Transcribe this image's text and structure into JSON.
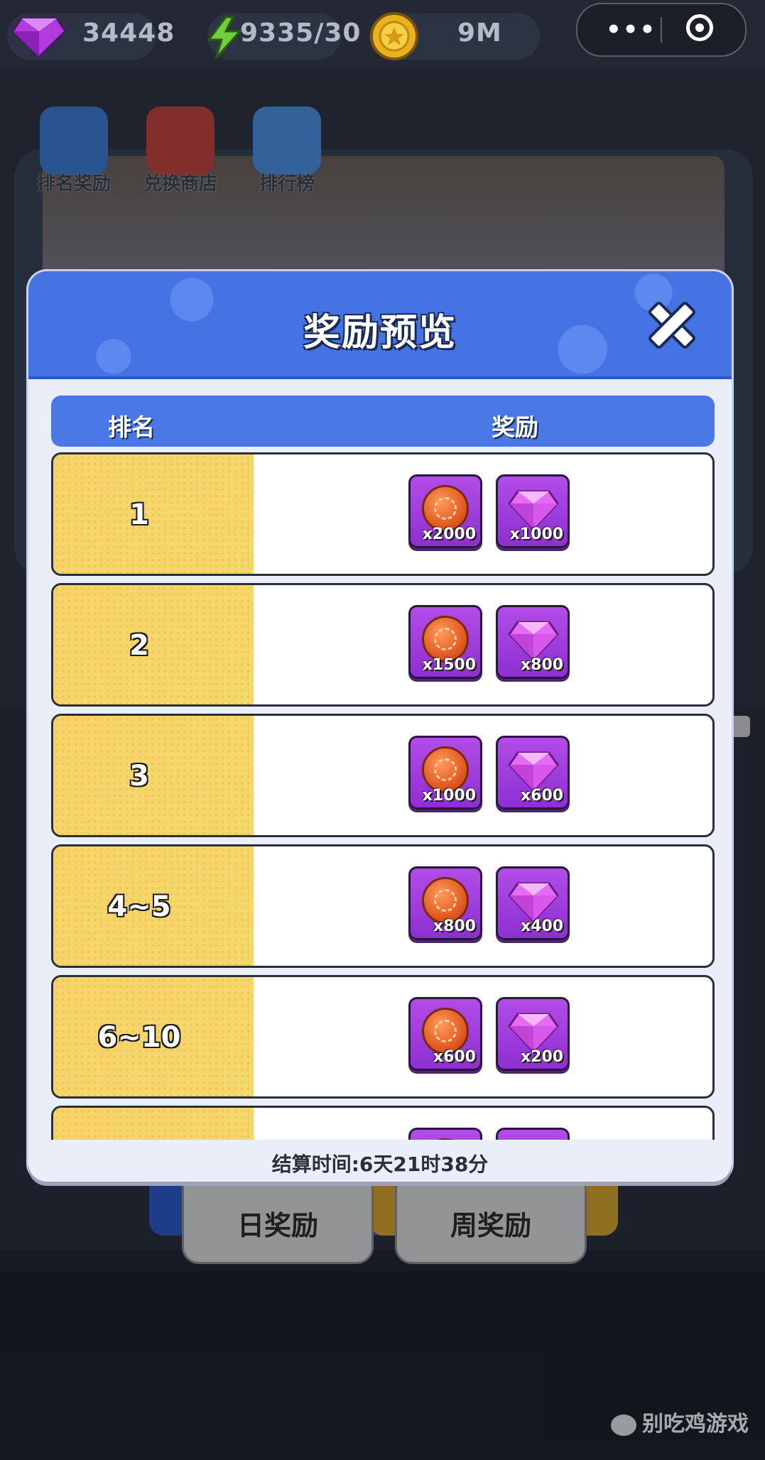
{
  "topbar": {
    "gems": "34448",
    "energy": "9335/30",
    "coins": "9M",
    "more_label": "•••",
    "icons": [
      "gem-icon",
      "lightning-icon",
      "gold-coin-icon",
      "more-icon",
      "target-icon"
    ]
  },
  "scene": {
    "menu": [
      {
        "label": "排名奖励",
        "icon": "gift-icon"
      },
      {
        "label": "兑换商店",
        "icon": "shop-icon"
      },
      {
        "label": "排行榜",
        "icon": "trophy-icon"
      }
    ],
    "tabs": {
      "daily": "日奖励",
      "weekly": "周奖励"
    },
    "watermark_side": "游戏",
    "watermark_brand": "别吃鸡游戏"
  },
  "modal": {
    "title": "奖励预览",
    "header_rank": "排名",
    "header_reward": "奖励",
    "settle_time": "结算时间:6天21时38分",
    "rows": [
      {
        "rank": "1",
        "coin_qty": "x2000",
        "gem_qty": "x1000"
      },
      {
        "rank": "2",
        "coin_qty": "x1500",
        "gem_qty": "x800"
      },
      {
        "rank": "3",
        "coin_qty": "x1000",
        "gem_qty": "x600"
      },
      {
        "rank": "4~5",
        "coin_qty": "x800",
        "gem_qty": "x400"
      },
      {
        "rank": "6~10",
        "coin_qty": "x600",
        "gem_qty": "x200"
      },
      {
        "rank": "",
        "coin_qty": "",
        "gem_qty": ""
      }
    ]
  },
  "colors": {
    "modal_header": "#4673e4",
    "rank_cell": "#f3d86d",
    "item_bg": "#a23fe0",
    "coin": "#e0561e"
  }
}
